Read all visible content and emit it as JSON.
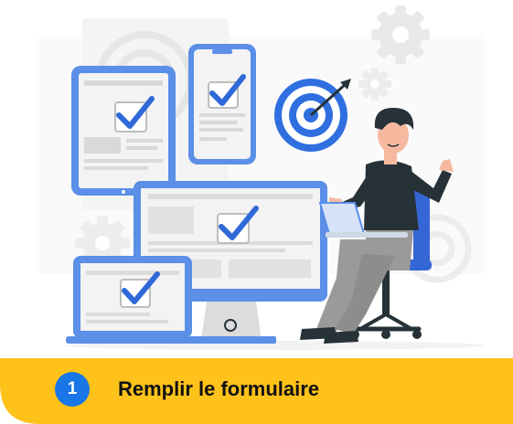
{
  "step": {
    "number": "1",
    "label": "Remplir le formulaire"
  },
  "colors": {
    "banner": "#ffc21a",
    "badge": "#1976e6",
    "device_frame": "#5b8fe8",
    "check": "#2f69d8",
    "target_blue": "#2f6fe0",
    "gear": "#e9e9e9",
    "pants": "#9a9a9a",
    "shirt": "#263238",
    "hair": "#263238",
    "chair": "#3566d6"
  },
  "icons": [
    "check-icon",
    "target-icon",
    "gear-icon",
    "person-illustration"
  ]
}
